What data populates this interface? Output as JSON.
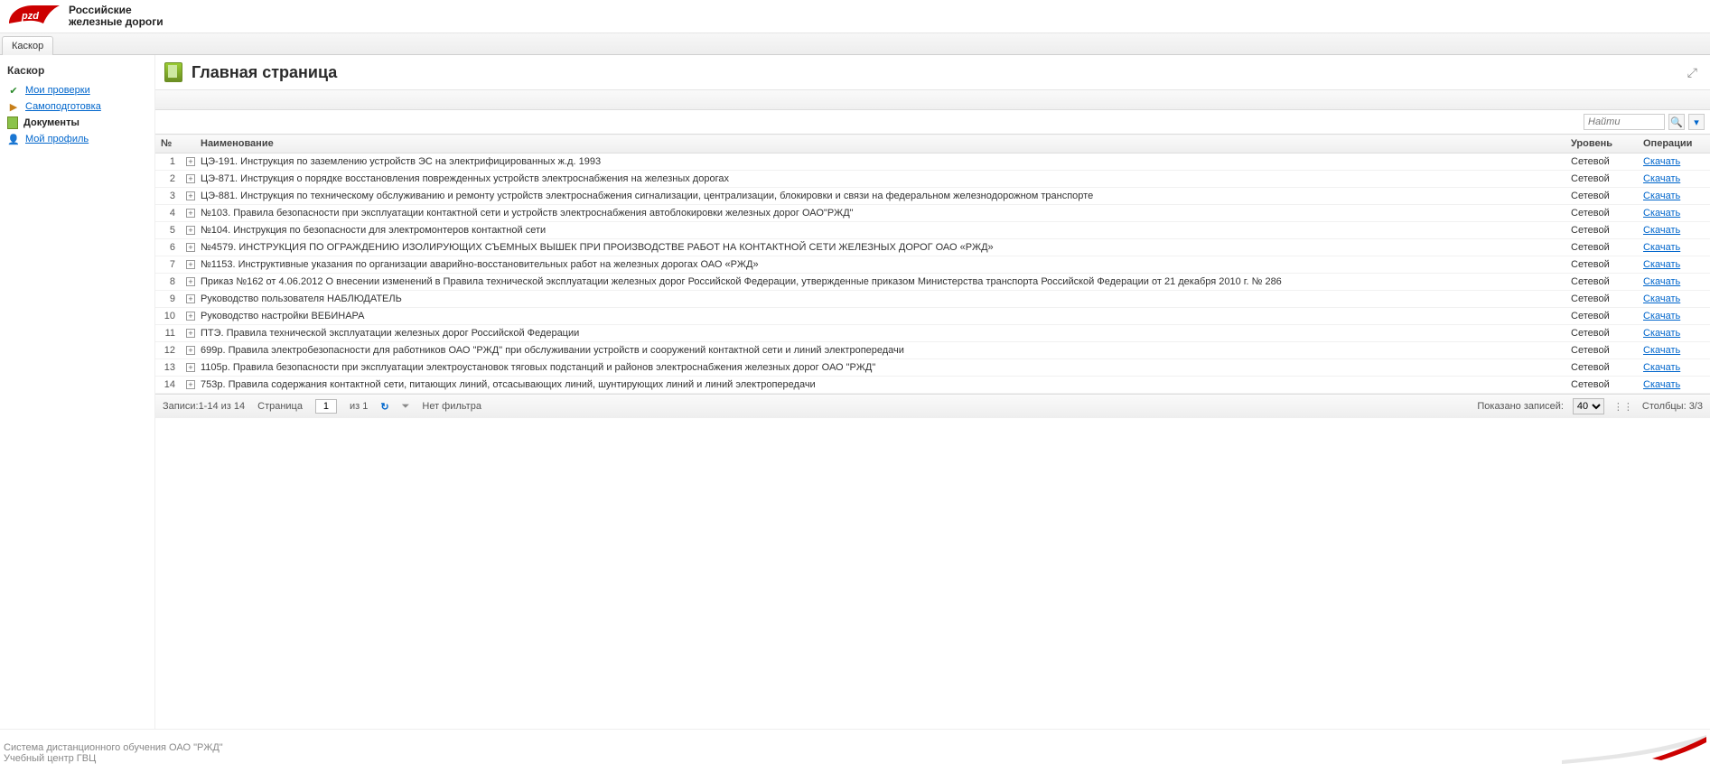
{
  "brand": {
    "l1": "Российские",
    "l2": "железные дороги"
  },
  "tab": "Каскор",
  "sidebar": {
    "title": "Каскор",
    "items": [
      {
        "label": "Мои проверки"
      },
      {
        "label": "Самоподготовка"
      },
      {
        "label": "Документы"
      },
      {
        "label": "Мой профиль"
      }
    ]
  },
  "page": {
    "title": "Главная страница"
  },
  "search": {
    "placeholder": "Найти"
  },
  "table": {
    "headers": {
      "num": "№",
      "name": "Наименование",
      "level": "Уровень",
      "ops": "Операции"
    },
    "level_value": "Сетевой",
    "download_label": "Скачать",
    "rows": [
      {
        "n": "1",
        "name": "ЦЭ-191. Инструкция по заземлению устройств ЭС на электрифицированных ж.д. 1993"
      },
      {
        "n": "2",
        "name": "ЦЭ-871. Инструкция о порядке восстановления поврежденных устройств электроснабжения на железных дорогах"
      },
      {
        "n": "3",
        "name": "ЦЭ-881. Инструкция по техническому обслуживанию и ремонту устройств электроснабжения сигнализации, централизации, блокировки и связи на федеральном железнодорожном транспорте"
      },
      {
        "n": "4",
        "name": "№103. Правила безопасности при эксплуатации контактной сети и устройств электроснабжения автоблокировки железных дорог ОАО\"РЖД\""
      },
      {
        "n": "5",
        "name": "№104. Инструкция по безопасности для электромонтеров контактной сети"
      },
      {
        "n": "6",
        "name": "№4579. ИНСТРУКЦИЯ ПО ОГРАЖДЕНИЮ ИЗОЛИРУЮЩИХ СЪЕМНЫХ ВЫШЕК ПРИ ПРОИЗВОДСТВЕ РАБОТ НА КОНТАКТНОЙ СЕТИ ЖЕЛЕЗНЫХ ДОРОГ ОАО «РЖД»"
      },
      {
        "n": "7",
        "name": "№1153. Инструктивные указания по организации аварийно-восстановительных работ на железных дорогах ОАО «РЖД»"
      },
      {
        "n": "8",
        "name": "Приказ №162 от 4.06.2012 О внесении изменений в Правила технической эксплуатации железных дорог Российской Федерации, утвержденные приказом Министерства транспорта Российской Федерации от 21 декабря 2010 г. № 286"
      },
      {
        "n": "9",
        "name": "Руководство пользователя НАБЛЮДАТЕЛЬ"
      },
      {
        "n": "10",
        "name": "Руководство настройки ВЕБИНАРА"
      },
      {
        "n": "11",
        "name": "ПТЭ. Правила технической эксплуатации железных дорог Российской Федерации"
      },
      {
        "n": "12",
        "name": "699р. Правила электробезопасности для работников ОАО \"РЖД\" при обслуживании устройств и сооружений контактной сети и линий электропередачи"
      },
      {
        "n": "13",
        "name": "1105р. Правила безопасности при эксплуатации электроустановок тяговых подстанций и районов электроснабжения железных дорог ОАО \"РЖД\""
      },
      {
        "n": "14",
        "name": "753р. Правила содержания контактной сети, питающих линий, отсасывающих линий, шунтирующих линий и линий электропередачи"
      }
    ]
  },
  "pager": {
    "records": "Записи:1-14 из 14",
    "page_label": "Страница",
    "page_value": "1",
    "page_of": "из 1",
    "no_filter": "Нет фильтра",
    "shown_label": "Показано записей:",
    "page_size": "40",
    "columns": "Столбцы: 3/3"
  },
  "footer": {
    "l1": "Система дистанционного обучения ОАО \"РЖД\"",
    "l2": "Учебный центр ГВЦ"
  }
}
